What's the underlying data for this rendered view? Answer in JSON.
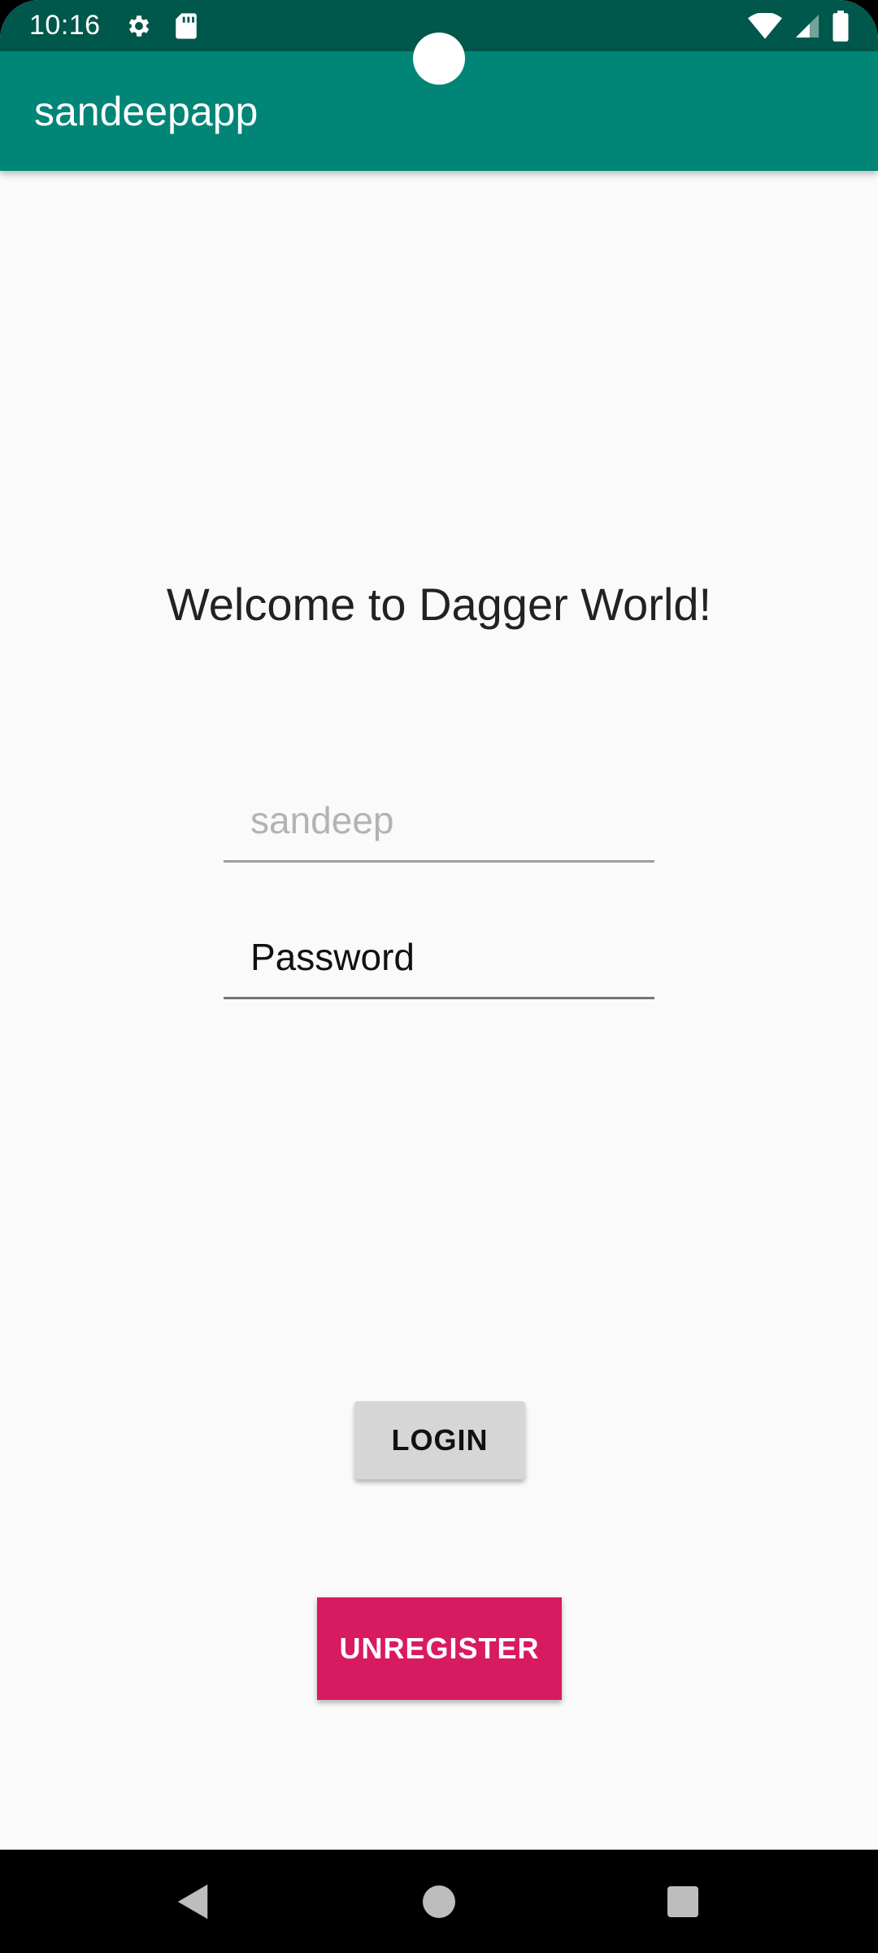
{
  "status_bar": {
    "time": "10:16",
    "icons": [
      "settings-icon",
      "sd-card-icon",
      "wifi-icon",
      "signal-icon",
      "battery-icon"
    ]
  },
  "app_bar": {
    "title": "sandeepapp"
  },
  "main": {
    "welcome_text": "Welcome to Dagger World!",
    "username_field": {
      "value": "",
      "placeholder": "sandeep"
    },
    "password_field": {
      "value": "Password",
      "placeholder": ""
    },
    "login_label": "LOGIN",
    "unregister_label": "UNREGISTER"
  },
  "colors": {
    "status_bar": "#00574b",
    "app_bar": "#008577",
    "accent": "#d81b60",
    "background": "#fafafa"
  },
  "nav_bar": {
    "icons": [
      "back-icon",
      "home-icon",
      "recents-icon"
    ]
  }
}
